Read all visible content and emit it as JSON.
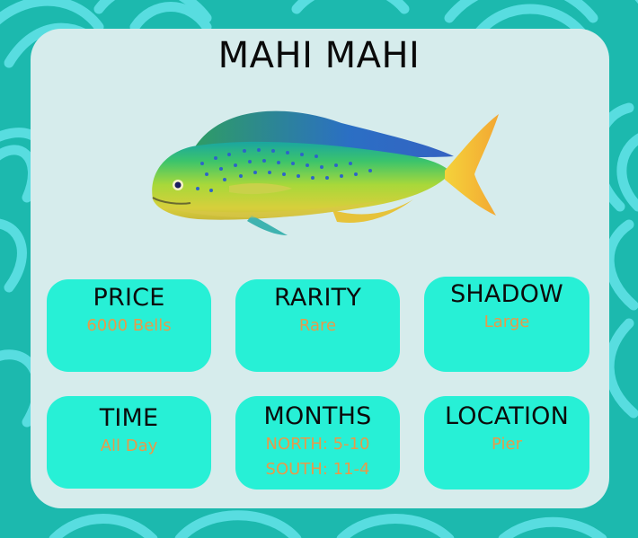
{
  "title": "MAHI MAHI",
  "colors": {
    "background": "#1cb9ae",
    "card": "#d6ecec",
    "tile": "#27f0d6",
    "value_text": "#e79a4a",
    "label_text": "#0b0b0b"
  },
  "image": {
    "icon": "mahi-mahi-fish-illustration"
  },
  "stats": {
    "price": {
      "label": "PRICE",
      "value": "6000 Bells"
    },
    "rarity": {
      "label": "RARITY",
      "value": "Rare"
    },
    "shadow": {
      "label": "SHADOW",
      "value": "Large"
    },
    "time": {
      "label": "TIME",
      "value": "All Day"
    },
    "months": {
      "label": "MONTHS",
      "north": "NORTH: 5-10",
      "south": "SOUTH: 11-4"
    },
    "location": {
      "label": "LOCATION",
      "value": "Pier"
    }
  }
}
